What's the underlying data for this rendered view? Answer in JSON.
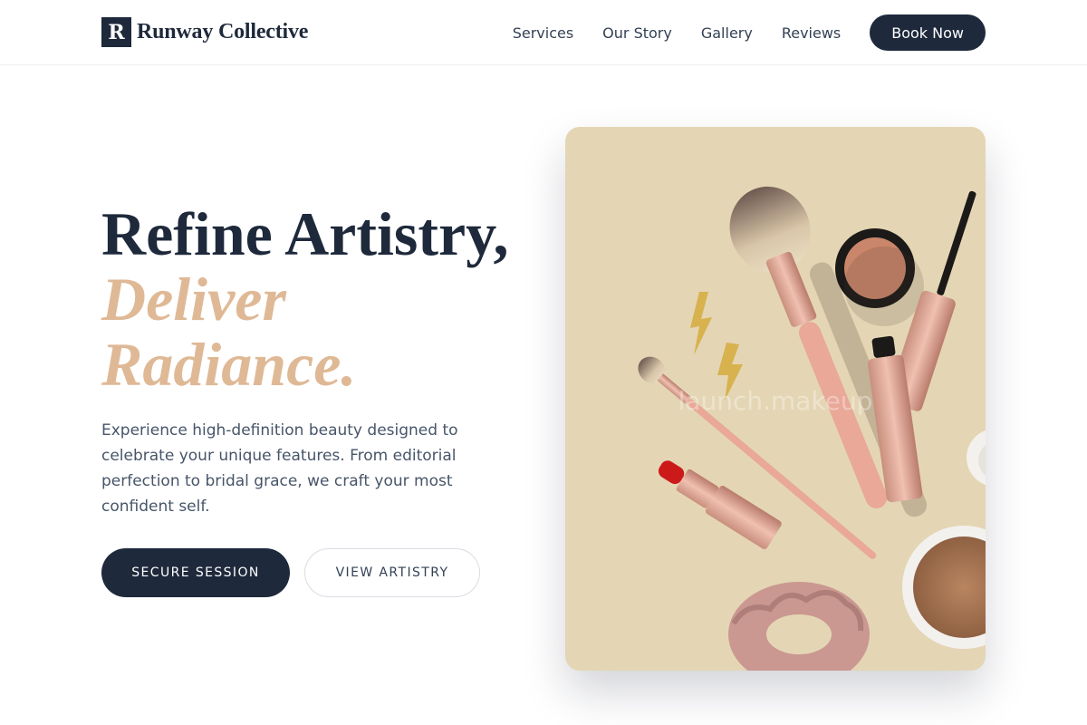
{
  "header": {
    "logo_mark": "R",
    "brand": "Runway Collective",
    "nav": [
      "Services",
      "Our Story",
      "Gallery",
      "Reviews"
    ],
    "cta": "Book Now"
  },
  "hero": {
    "title_line1": "Refine Artistry,",
    "title_line2": "Deliver",
    "title_line3": "Radiance.",
    "description": "Experience high-definition beauty designed to celebrate your unique features. From editorial perfection to bridal grace, we craft your most confident self.",
    "primary_button": "SECURE SESSION",
    "secondary_button": "VIEW ARTISTRY",
    "image_watermark": "launch.makeup"
  },
  "colors": {
    "navy": "#1e293b",
    "accent": "#dfb996",
    "image_bg": "#e4d6b4"
  }
}
